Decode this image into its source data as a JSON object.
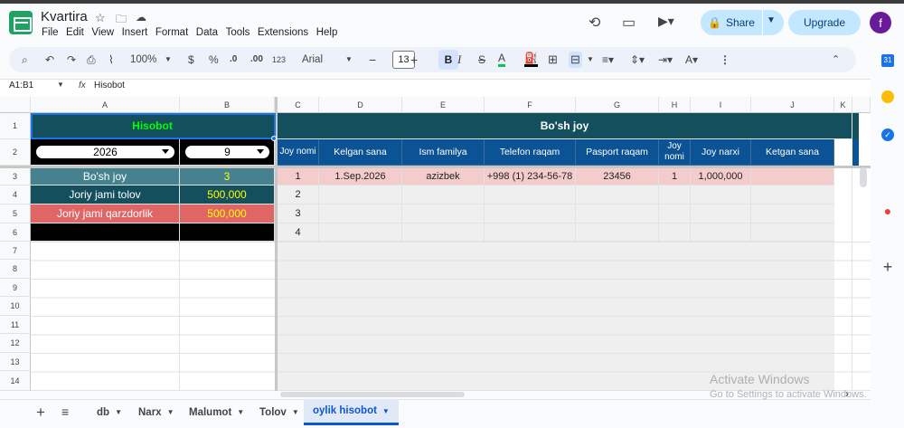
{
  "app": {
    "title": "Kvartira",
    "menu": [
      "File",
      "Edit",
      "View",
      "Insert",
      "Format",
      "Data",
      "Tools",
      "Extensions",
      "Help"
    ],
    "share_label": "Share",
    "upgrade_label": "Upgrade",
    "avatar_letter": "f"
  },
  "toolbar": {
    "zoom": "100%",
    "currency": "$",
    "percent": "%",
    "dec_decrease": ".0",
    "dec_increase": ".00",
    "format_more": "123",
    "font": "Arial",
    "font_size": "13",
    "bold": "B",
    "italic": "I",
    "strike": "S",
    "text_color": "A"
  },
  "formula_bar": {
    "name_box": "A1:B1",
    "fx": "fx",
    "content": "Hisobot"
  },
  "side_panel": {
    "calendar_day": "31"
  },
  "grid": {
    "columns": [
      "A",
      "B",
      "C",
      "D",
      "E",
      "F",
      "G",
      "H",
      "I",
      "J",
      "K"
    ],
    "rows": [
      "1",
      "2",
      "3",
      "4",
      "5",
      "6",
      "7",
      "8",
      "9",
      "10",
      "11",
      "12",
      "13",
      "14"
    ],
    "left": {
      "title": "Hisobot",
      "year": "2026",
      "month": "9",
      "rows": [
        {
          "label": "Bo'sh joy",
          "value": "3"
        },
        {
          "label": "Joriy jami tolov",
          "value": "500,000"
        },
        {
          "label": "Joriy jami qarzdorlik",
          "value": "500,000"
        }
      ]
    },
    "right": {
      "title": "Bo'sh joy",
      "headers": [
        "Joy nomi",
        "Kelgan sana",
        "Ism familya",
        "Telefon raqam",
        "Pasport raqam",
        "Joy nomi",
        "Joy narxi",
        "Ketgan sana"
      ],
      "rows": [
        [
          "1",
          "1.Sep.2026",
          "azizbek",
          "+998 (1) 234-56-78",
          "23456",
          "1",
          "1,000,000",
          ""
        ],
        [
          "2",
          "",
          "",
          "",
          "",
          "",
          "",
          ""
        ],
        [
          "3",
          "",
          "",
          "",
          "",
          "",
          "",
          ""
        ],
        [
          "4",
          "",
          "",
          "",
          "",
          "",
          "",
          ""
        ]
      ]
    }
  },
  "sheets": {
    "tabs": [
      {
        "label": "db"
      },
      {
        "label": "Narx"
      },
      {
        "label": "Malumot"
      },
      {
        "label": "Tolov"
      },
      {
        "label": "oylik hisobot"
      }
    ]
  },
  "watermark": {
    "line1": "Activate Windows",
    "line2": "Go to Settings to activate Windows."
  },
  "colors": {
    "header_dark": "#134f5c",
    "header_blue": "#0b5394",
    "row_teal": "#45818e",
    "row_red": "#e06666",
    "pink_row": "#f4cccc",
    "yellow_text": "#ffff00",
    "green_text": "#00ff00"
  }
}
